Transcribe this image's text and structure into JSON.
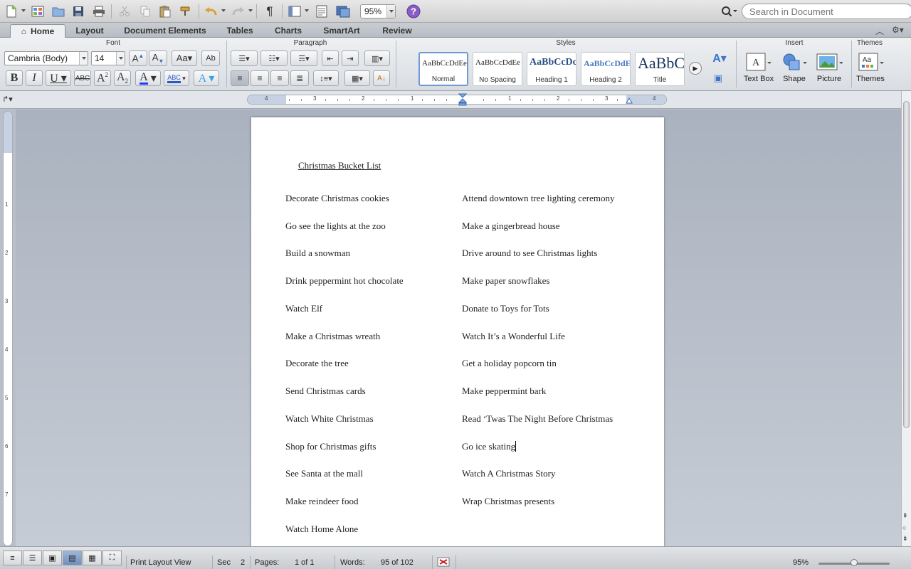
{
  "toolbar": {
    "zoom_value": "95%",
    "search_placeholder": "Search in Document"
  },
  "tabs": [
    "Home",
    "Layout",
    "Document Elements",
    "Tables",
    "Charts",
    "SmartArt",
    "Review"
  ],
  "ribbon": {
    "groups": {
      "font": "Font",
      "paragraph": "Paragraph",
      "styles": "Styles",
      "insert": "Insert",
      "themes": "Themes"
    },
    "font_name": "Cambria (Body)",
    "font_size": "14",
    "styles": [
      {
        "sample": "AaBbCcDdEe",
        "name": "Normal"
      },
      {
        "sample": "AaBbCcDdEe",
        "name": "No Spacing"
      },
      {
        "sample": "AaBbCcDc",
        "name": "Heading 1"
      },
      {
        "sample": "AaBbCcDdEe",
        "name": "Heading 2"
      },
      {
        "sample": "AaBbC",
        "name": "Title"
      }
    ],
    "insert": {
      "text_box": "Text Box",
      "shape": "Shape",
      "picture": "Picture"
    },
    "themes": "Themes",
    "colors": {
      "font_color": "#1f3fff",
      "highlight": "#2a57c9",
      "style_selected": "#6f98d4"
    }
  },
  "document": {
    "title": "Christmas Bucket List",
    "left_items": [
      "Decorate Christmas cookies",
      "Go see the lights at the zoo",
      "Build a snowman",
      "Drink peppermint hot chocolate",
      "Watch Elf",
      "Make a Christmas wreath",
      "Decorate the tree",
      "Send Christmas cards",
      "Watch White Christmas",
      "Shop for Christmas gifts",
      "See Santa at the mall",
      "Make reindeer food",
      "Watch Home Alone"
    ],
    "right_items": [
      "Attend downtown tree lighting ceremony",
      "Make a gingerbread house",
      "Drive around to see Christmas lights",
      "Make paper snowflakes",
      "Donate to Toys for Tots",
      "Watch It’s a Wonderful Life",
      "Get a holiday popcorn tin",
      "Make peppermint bark",
      "Read ‘Twas The Night Before Christmas",
      "Go ice skating",
      "Watch A Christmas Story",
      "Wrap Christmas presents"
    ]
  },
  "ruler": {
    "labels": [
      "4",
      "3",
      "2",
      "1",
      "1",
      "2",
      "3",
      "4"
    ]
  },
  "vruler": {
    "labels": [
      "1",
      "2",
      "3",
      "4",
      "5",
      "6",
      "7"
    ]
  },
  "status": {
    "view_name": "Print Layout View",
    "sec_label": "Sec",
    "sec_value": "2",
    "pages_label": "Pages:",
    "pages_value": "1 of 1",
    "words_label": "Words:",
    "words_value": "95 of 102",
    "zoom": "95%"
  }
}
